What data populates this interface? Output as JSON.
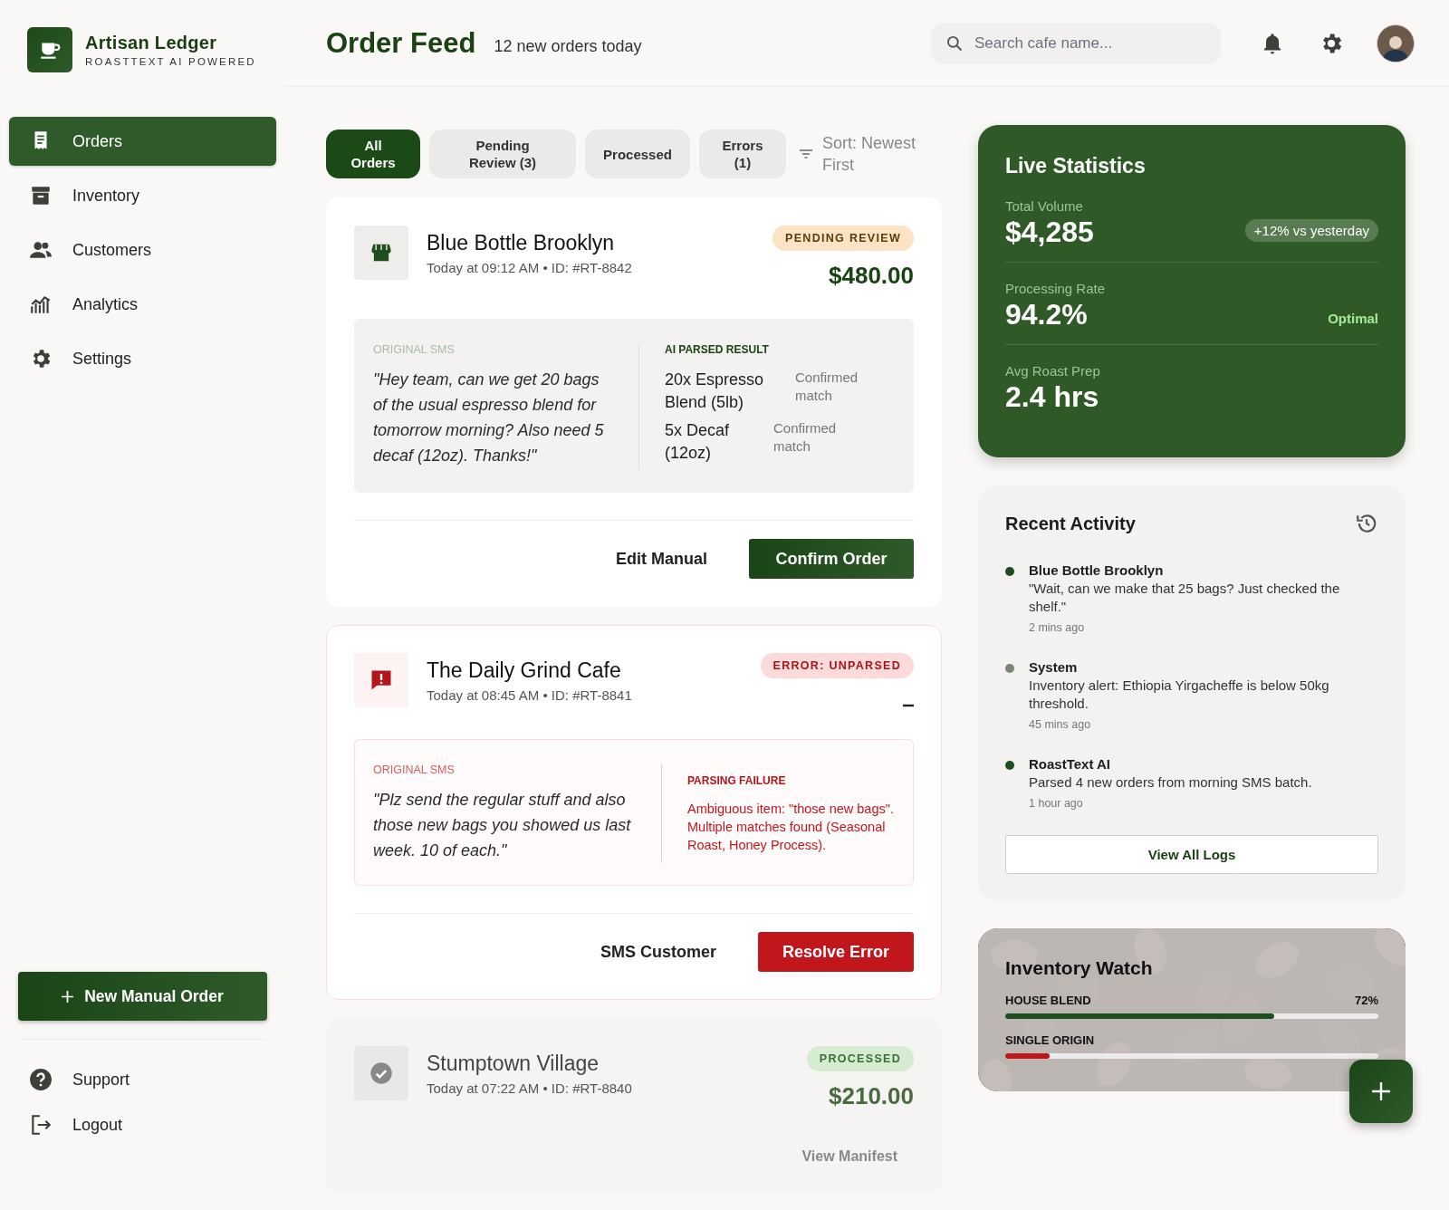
{
  "brand": {
    "name": "Artisan Ledger",
    "tagline": "ROASTTEXT AI POWERED"
  },
  "nav": [
    {
      "label": "Orders",
      "selected": true
    },
    {
      "label": "Inventory",
      "selected": false
    },
    {
      "label": "Customers",
      "selected": false
    },
    {
      "label": "Analytics",
      "selected": false
    },
    {
      "label": "Settings",
      "selected": false
    }
  ],
  "new_order_button": "New Manual Order",
  "footer_nav": [
    {
      "label": "Support"
    },
    {
      "label": "Logout"
    }
  ],
  "header": {
    "title": "Order Feed",
    "subtitle": "12 new orders today",
    "search": {
      "placeholder": "Search cafe name..."
    }
  },
  "filters": [
    {
      "label": "All Orders",
      "selected": true
    },
    {
      "label": "Pending Review (3)",
      "selected": false
    },
    {
      "label": "Processed",
      "selected": false
    },
    {
      "label": "Errors (1)",
      "selected": false
    }
  ],
  "sort": "Sort: Newest First",
  "orders": [
    {
      "kind": "pending",
      "name": "Blue Bottle Brooklyn",
      "meta": "Today at 09:12 AM • ID: #RT-8842",
      "badge": "PENDING REVIEW",
      "amount": "$480.00",
      "sms_label": "ORIGINAL SMS",
      "sms": "\"Hey team, can we get 20 bags of the usual espresso blend for tomorrow morning? Also need 5 decaf (12oz). Thanks!\"",
      "result_label": "AI PARSED RESULT",
      "items": [
        {
          "name": "20x Espresso Blend (5lb)",
          "note": "Confirmed match"
        },
        {
          "name": "5x Decaf (12oz)",
          "note": "Confirmed match"
        }
      ],
      "actions": [
        {
          "label": "Edit Manual",
          "kind": "text"
        },
        {
          "label": "Confirm Order",
          "kind": "primary"
        }
      ]
    },
    {
      "kind": "error",
      "name": "The Daily Grind Cafe",
      "meta": "Today at 08:45 AM • ID: #RT-8841",
      "badge": "ERROR: UNPARSED",
      "sms_label": "ORIGINAL SMS",
      "sms": "\"Plz send the regular stuff and also those new bags you showed us last week. 10 of each.\"",
      "result_label": "PARSING FAILURE",
      "failure": "Ambiguous item: \"those new bags\". Multiple matches found (Seasonal Roast, Honey Process).",
      "actions": [
        {
          "label": "SMS Customer",
          "kind": "text"
        },
        {
          "label": "Resolve Error",
          "kind": "danger"
        }
      ]
    },
    {
      "kind": "processed",
      "name": "Stumptown Village",
      "meta": "Today at 07:22 AM • ID: #RT-8840",
      "badge": "PROCESSED",
      "amount": "$210.00",
      "link": "View Manifest"
    }
  ],
  "stats": {
    "title": "Live Statistics",
    "rows": [
      {
        "label": "Total Volume",
        "value": "$4,285",
        "note": "+12% vs yesterday",
        "kind": "trend"
      },
      {
        "label": "Processing Rate",
        "value": "94.2%",
        "note": "Optimal",
        "kind": "status"
      },
      {
        "label": "Avg Roast Prep",
        "value": "2.4 hrs"
      }
    ]
  },
  "activity": {
    "title": "Recent Activity",
    "items": [
      {
        "source": "Blue Bottle Brooklyn",
        "message": "\"Wait, can we make that 25 bags? Just checked the shelf.\"",
        "time": "2 mins ago",
        "color": "#1e4d1e"
      },
      {
        "source": "System",
        "message": "Inventory alert: Ethiopia Yirgacheffe is below 50kg threshold.",
        "time": "45 mins ago",
        "color": "#7d8478"
      },
      {
        "source": "RoastText AI",
        "message": "Parsed 4 new orders from morning SMS batch.",
        "time": "1 hour ago",
        "color": "#1e4d1e"
      }
    ],
    "button": "View All Logs"
  },
  "inventory": {
    "title": "Inventory Watch",
    "items": [
      {
        "name": "HOUSE BLEND",
        "reading": "72%",
        "level": 0.72,
        "color": "#1e4d1e"
      },
      {
        "name": "SINGLE ORIGIN",
        "level": 0.12,
        "color": "#c0161c"
      }
    ]
  }
}
